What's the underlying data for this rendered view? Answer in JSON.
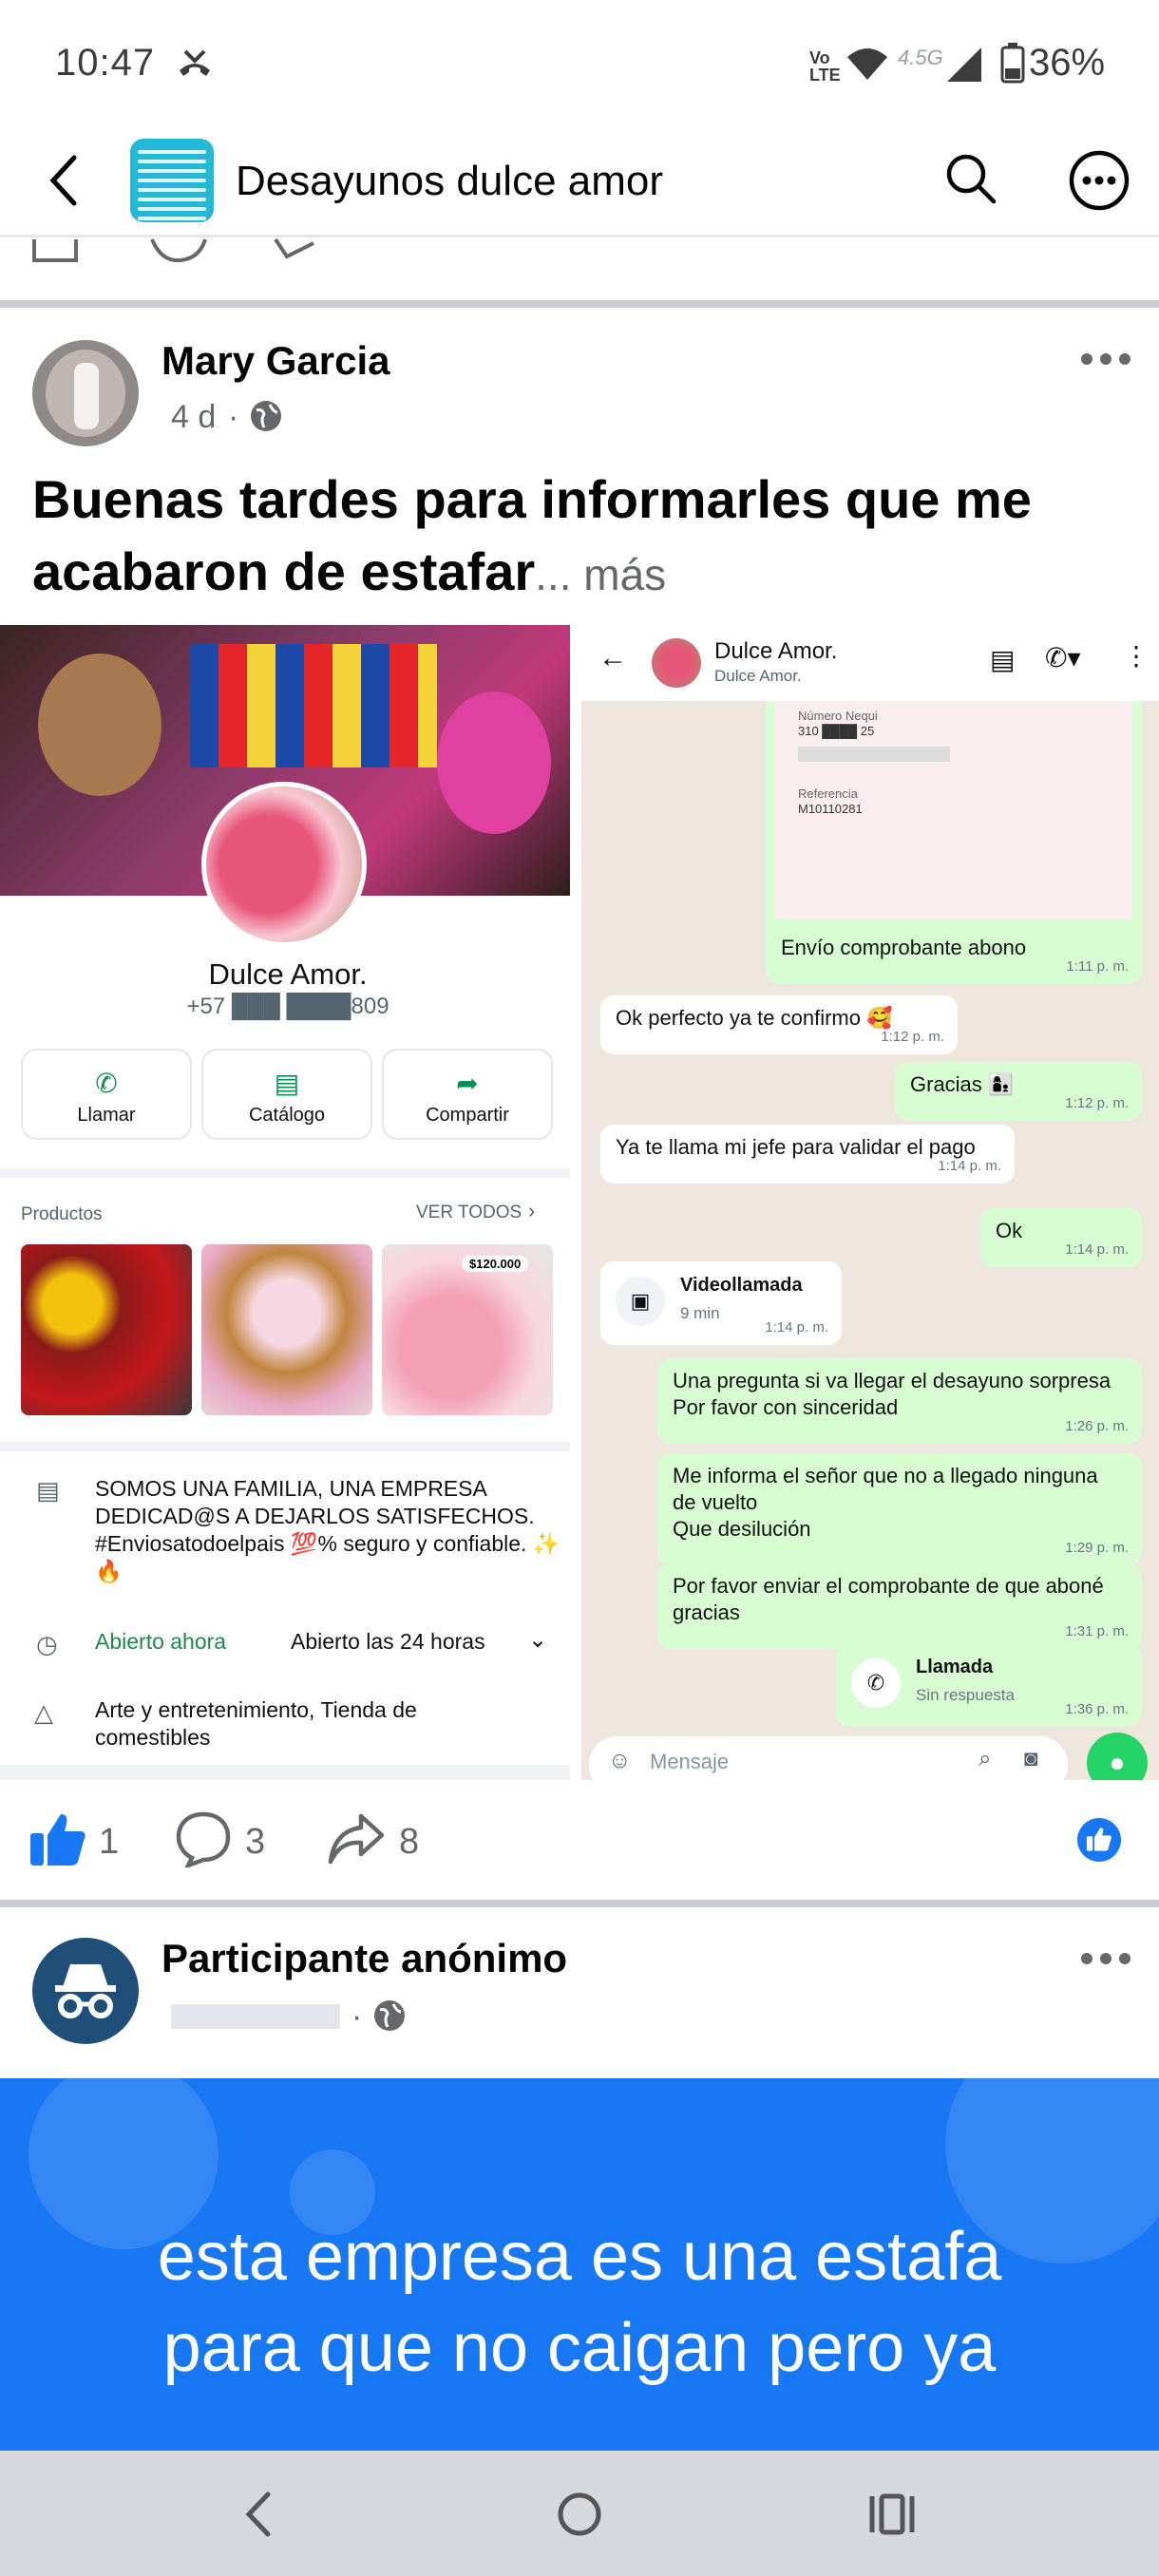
{
  "status_bar": {
    "time": "10:47",
    "network": "4.5G",
    "battery": "36%"
  },
  "group": {
    "title": "Desayunos dulce amor"
  },
  "post1": {
    "author": "Mary Garcia",
    "time": "4 d",
    "text": "Buenas tardes para informarles que me acabaron de estafar",
    "more": "... más",
    "reactions": {
      "likes": "1",
      "comments": "3",
      "shares": "8"
    }
  },
  "profile_shot": {
    "name": "Dulce Amor.",
    "phone": "+57 ███ ████809",
    "buttons": [
      "Llamar",
      "Catálogo",
      "Compartir"
    ],
    "products_label": "Productos",
    "see_all": "VER TODOS",
    "price_tag": "$120.000",
    "description": "SOMOS UNA FAMILIA, UNA EMPRESA DEDICAD@S A DEJARLOS SATISFECHOS. #Enviosatodoelpais 💯% seguro y confiable. ✨🔥",
    "open_now": "Abierto ahora",
    "hours": "Abierto las 24 horas",
    "category": "Arte y entretenimiento, Tienda de comestibles"
  },
  "chat_shot": {
    "contact": "Dulce Amor.",
    "contact_sub": "Dulce Amor.",
    "receipt_label1": "Número Nequi",
    "receipt_num": "310 ████ 25",
    "receipt_label2": "Referencia",
    "receipt_ref": "M10110281",
    "messages": [
      {
        "text": "Envío comprobante abono",
        "time": "1:11 p. m."
      },
      {
        "text": "Ok perfecto ya te confirmo 🥰",
        "time": "1:12 p. m."
      },
      {
        "text": "Gracias 👩‍👦",
        "time": "1:12 p. m."
      },
      {
        "text": "Ya te llama mi jefe para validar el pago",
        "time": "1:14 p. m."
      },
      {
        "text": "Ok",
        "time": "1:14 p. m."
      },
      {
        "text": "Videollamada",
        "sub": "9 min",
        "time": "1:14 p. m."
      },
      {
        "text": "Una pregunta si va llegar el desayuno sorpresa\nPor favor con sinceridad",
        "time": "1:26 p. m."
      },
      {
        "text": "Me informa el señor que no a llegado ninguna de vuelto\nQue desilución",
        "time": "1:29 p. m."
      },
      {
        "text": "Por favor enviar el comprobante de que aboné gracias",
        "time": "1:31 p. m."
      },
      {
        "text": "Llamada",
        "sub": "Sin respuesta",
        "time": "1:36 p. m."
      }
    ],
    "input_placeholder": "Mensaje"
  },
  "post2": {
    "author": "Participante anónimo",
    "banner_line1": "esta empresa es una estafa",
    "banner_line2": "para que no caigan pero ya"
  },
  "colors": {
    "fb_blue": "#1877f2",
    "wa_green": "#25d366",
    "wa_out": "#d9fdd3"
  }
}
